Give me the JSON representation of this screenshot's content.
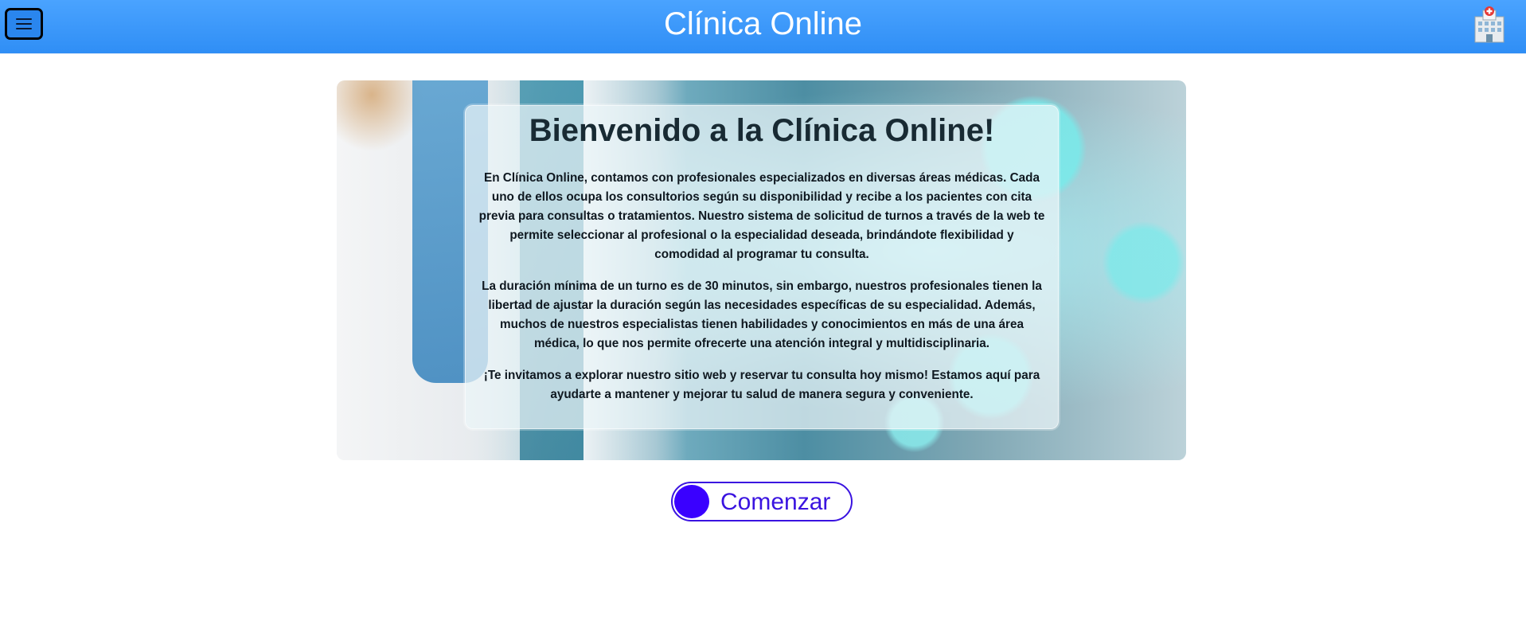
{
  "header": {
    "title": "Clínica Online",
    "menu_icon": "hamburger-icon",
    "logo_icon": "hospital-icon"
  },
  "hero": {
    "heading": "Bienvenido a la Clínica Online!",
    "paragraphs": [
      "En Clínica Online, contamos con profesionales especializados en diversas áreas médicas. Cada uno de ellos ocupa los consultorios según su disponibilidad y recibe a los pacientes con cita previa para consultas o tratamientos. Nuestro sistema de solicitud de turnos a través de la web te permite seleccionar al profesional o la especialidad deseada, brindándote flexibilidad y comodidad al programar tu consulta.",
      "La duración mínima de un turno es de 30 minutos, sin embargo, nuestros profesionales tienen la libertad de ajustar la duración según las necesidades específicas de su especialidad. Además, muchos de nuestros especialistas tienen habilidades y conocimientos en más de una área médica, lo que nos permite ofrecerte una atención integral y multidisciplinaria.",
      "¡Te invitamos a explorar nuestro sitio web y reservar tu consulta hoy mismo! Estamos aquí para ayudarte a mantener y mejorar tu salud de manera segura y conveniente."
    ]
  },
  "actions": {
    "start_label": "Comenzar"
  },
  "colors": {
    "header_bg": "#3396f7",
    "button_accent": "#3a13e0",
    "button_knob": "#3a00ff"
  }
}
